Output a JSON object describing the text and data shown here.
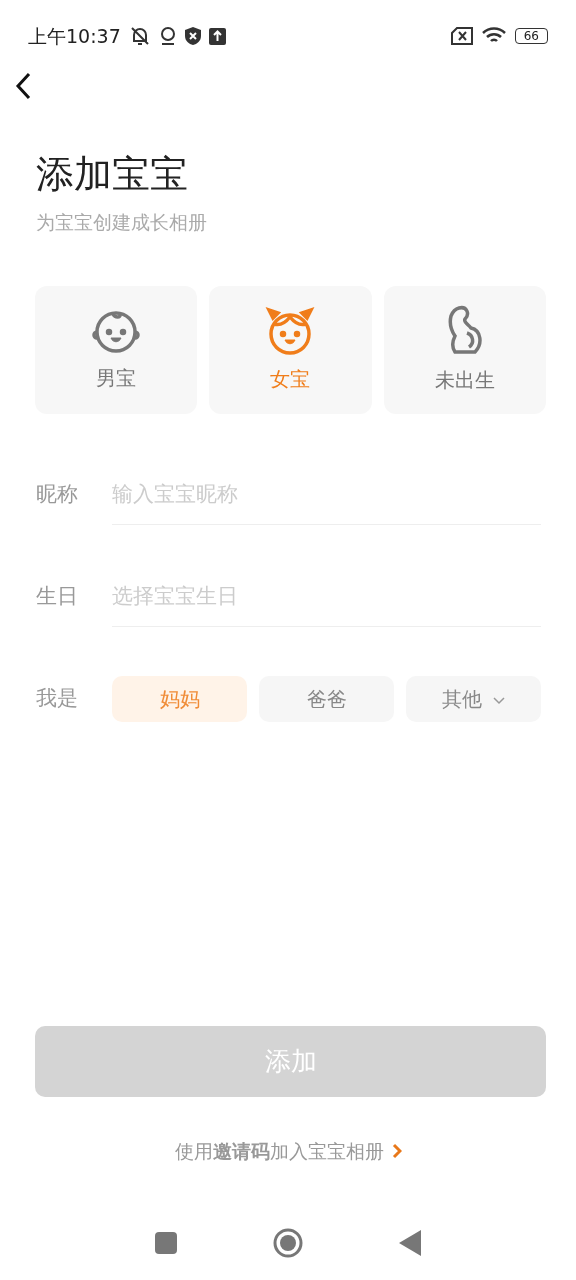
{
  "status_bar": {
    "time": "上午10:37",
    "battery": "66"
  },
  "title": "添加宝宝",
  "subtitle": "为宝宝创建成长相册",
  "baby_types": [
    {
      "kind": "boy",
      "label": "男宝",
      "selected": false
    },
    {
      "kind": "girl",
      "label": "女宝",
      "selected": true
    },
    {
      "kind": "unborn",
      "label": "未出生",
      "selected": false
    }
  ],
  "fields": [
    {
      "label": "昵称",
      "placeholder": "输入宝宝昵称"
    },
    {
      "label": "生日",
      "placeholder": "选择宝宝生日"
    }
  ],
  "relation": {
    "label": "我是",
    "options": [
      {
        "kind": "option",
        "label": "妈妈",
        "selected": true
      },
      {
        "kind": "option",
        "label": "爸爸",
        "selected": false
      },
      {
        "kind": "dropdown",
        "label": "其他",
        "selected": false
      }
    ]
  },
  "add_button": {
    "label": "添加",
    "disabled": true
  },
  "invite_link": "使用**邀请码**加入宝宝相册"
}
